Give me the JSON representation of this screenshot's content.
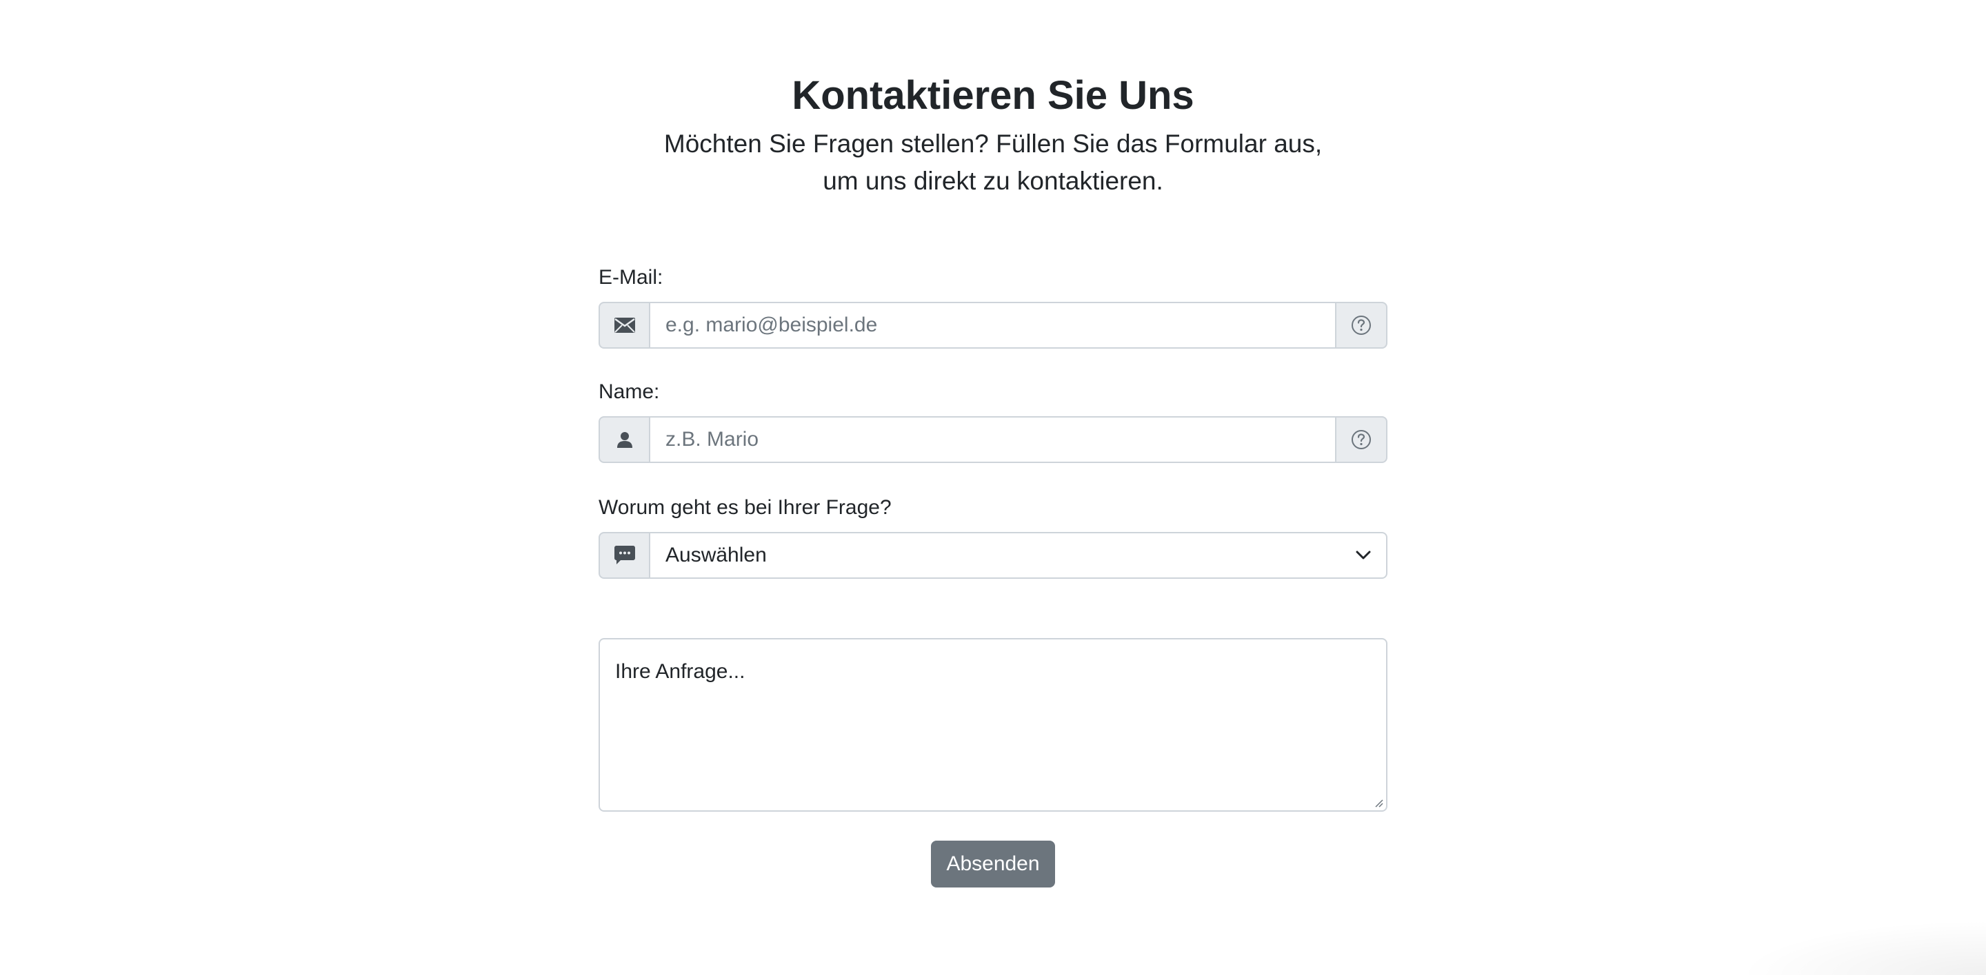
{
  "header": {
    "title": "Kontaktieren Sie Uns",
    "subtitle_line1": "Möchten Sie Fragen stellen? Füllen Sie das Formular aus,",
    "subtitle_line2": "um uns direkt zu kontaktieren."
  },
  "form": {
    "email": {
      "label": "E-Mail:",
      "placeholder": "e.g. mario@beispiel.de",
      "icon": "envelope-icon",
      "help_icon": "question-circle-icon"
    },
    "name": {
      "label": "Name:",
      "placeholder": "z.B. Mario",
      "icon": "person-icon",
      "help_icon": "question-circle-icon"
    },
    "topic": {
      "label": "Worum geht es bei Ihrer Frage?",
      "selected": "Auswählen",
      "icon": "chat-icon"
    },
    "message": {
      "placeholder": "Ihre Anfrage..."
    },
    "submit_label": "Absenden"
  },
  "colors": {
    "text": "#212529",
    "muted": "#6c757d",
    "border": "#ced4da",
    "addon_bg": "#e9ecef",
    "button_bg": "#6c757d"
  }
}
